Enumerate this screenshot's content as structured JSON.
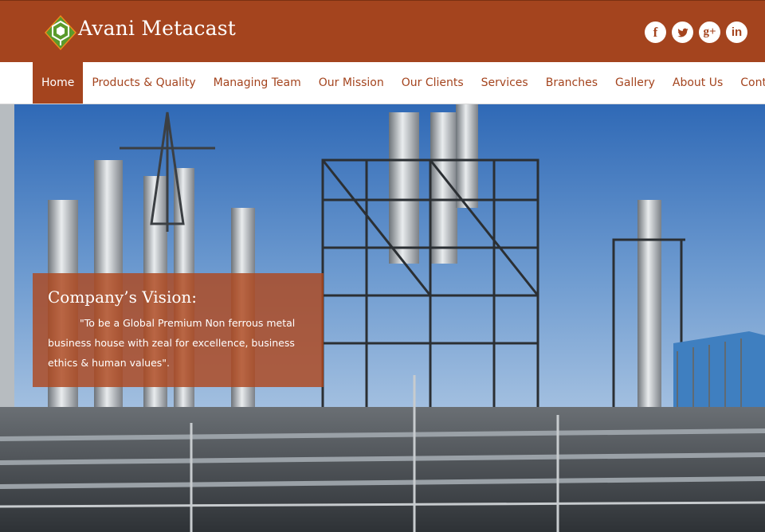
{
  "header": {
    "brand": "Avani Metacast",
    "logo_colors": [
      "#5a9a2c",
      "#f08a1c"
    ],
    "socials": [
      {
        "name": "facebook",
        "icon": "facebook-icon",
        "glyph": "f"
      },
      {
        "name": "twitter",
        "icon": "twitter-icon",
        "glyph": ""
      },
      {
        "name": "google-plus",
        "icon": "google-plus-icon",
        "glyph": "g+"
      },
      {
        "name": "linkedin",
        "icon": "linkedin-icon",
        "glyph": "in"
      }
    ]
  },
  "nav": {
    "items": [
      {
        "label": "Home",
        "active": true
      },
      {
        "label": "Products & Quality"
      },
      {
        "label": "Managing Team"
      },
      {
        "label": "Our Mission"
      },
      {
        "label": "Our Clients"
      },
      {
        "label": "Services"
      },
      {
        "label": "Branches"
      },
      {
        "label": "Gallery"
      },
      {
        "label": "About Us"
      },
      {
        "label": "Contact Us"
      }
    ]
  },
  "hero": {
    "image": "industrial-refinery-photo",
    "vision_title": "Company’s Vision:",
    "vision_text": "\"To be a Global Premium Non ferrous metal business house with zeal for excellence, business ethics & human values\"."
  },
  "colors": {
    "brand": "#a4441e",
    "nav_text": "#a4441e",
    "active_text": "#ffffff"
  }
}
